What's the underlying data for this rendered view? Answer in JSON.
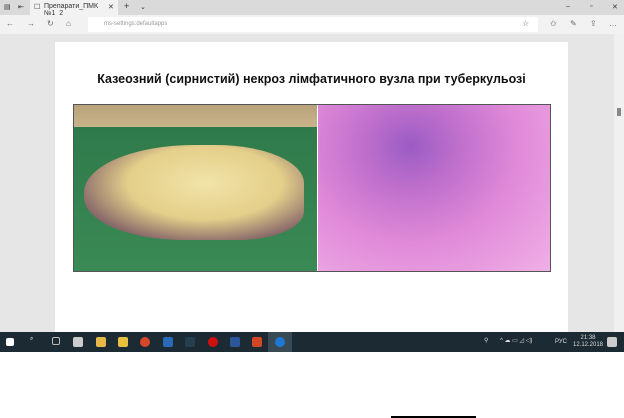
{
  "browser": {
    "tab_title": "Препарати_ПМК №1_2",
    "url": "ms-settings:defaultapps"
  },
  "slide": {
    "title": "Казеозний (сирнистий) некроз лімфатичного вузла при туберкульозі"
  },
  "taskbar": {
    "language": "РУС",
    "time": "21:38",
    "date": "12.12.2018",
    "colors": {
      "bg": "#1c2a33"
    }
  }
}
